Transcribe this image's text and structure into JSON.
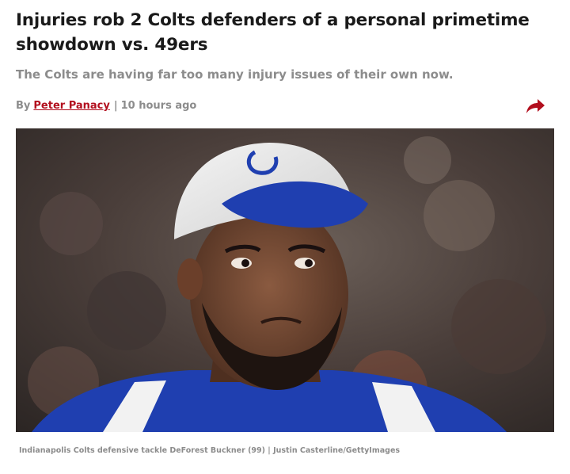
{
  "article": {
    "headline": "Injuries rob 2 Colts defenders of a personal primetime showdown vs. 49ers",
    "subheadline": "The Colts are having far too many injury issues of their own now.",
    "byline": {
      "prefix": "By",
      "author": "Peter Panacy",
      "separator": "|",
      "time": "10 hours ago"
    },
    "share_icon": "share-arrow-icon",
    "image": {
      "subject": "football-player-photo",
      "caption": "Indianapolis Colts defensive tackle DeForest Buckner (99) | Justin Casterline/GettyImages"
    }
  },
  "colors": {
    "author_link": "#b20f1e",
    "share_icon": "#b20f1e",
    "muted_text": "#8c8c8c",
    "headline_text": "#1a1a1a",
    "jersey_blue": "#1f3fb0"
  }
}
